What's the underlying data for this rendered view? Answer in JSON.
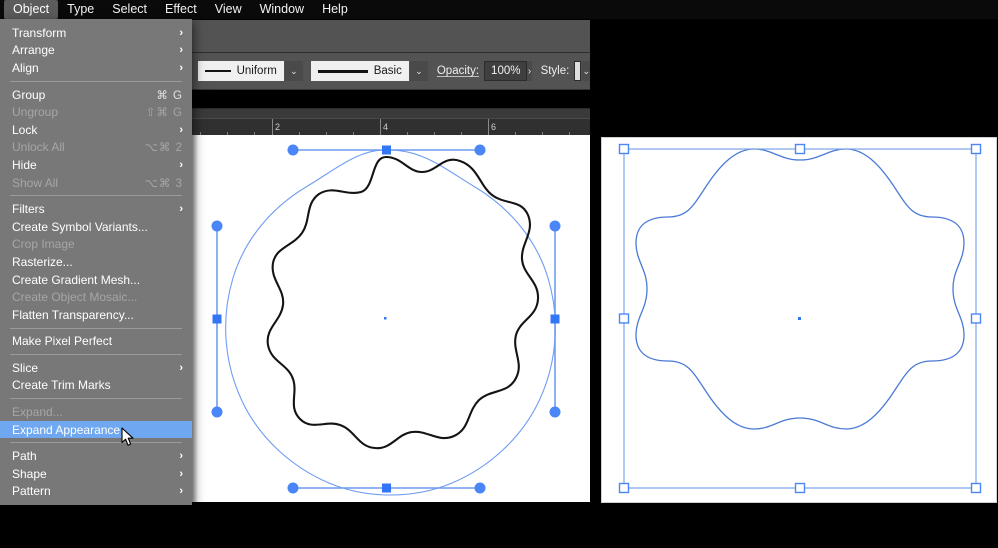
{
  "menubar": {
    "items": [
      {
        "label": "Object",
        "active": true
      },
      {
        "label": "Type",
        "active": false
      },
      {
        "label": "Select",
        "active": false
      },
      {
        "label": "Effect",
        "active": false
      },
      {
        "label": "View",
        "active": false
      },
      {
        "label": "Window",
        "active": false
      },
      {
        "label": "Help",
        "active": false
      }
    ]
  },
  "object_menu": {
    "groups": [
      {
        "items": [
          {
            "label": "Transform",
            "shortcut": "",
            "submenu": true,
            "disabled": false,
            "selected": false
          },
          {
            "label": "Arrange",
            "shortcut": "",
            "submenu": true,
            "disabled": false,
            "selected": false
          },
          {
            "label": "Align",
            "shortcut": "",
            "submenu": true,
            "disabled": false,
            "selected": false
          }
        ]
      },
      {
        "items": [
          {
            "label": "Group",
            "shortcut": "⌘ G",
            "submenu": false,
            "disabled": false,
            "selected": false
          },
          {
            "label": "Ungroup",
            "shortcut": "⇧⌘ G",
            "submenu": false,
            "disabled": true,
            "selected": false
          },
          {
            "label": "Lock",
            "shortcut": "",
            "submenu": true,
            "disabled": false,
            "selected": false
          },
          {
            "label": "Unlock All",
            "shortcut": "⌥⌘ 2",
            "submenu": false,
            "disabled": true,
            "selected": false
          },
          {
            "label": "Hide",
            "shortcut": "",
            "submenu": true,
            "disabled": false,
            "selected": false
          },
          {
            "label": "Show All",
            "shortcut": "⌥⌘ 3",
            "submenu": false,
            "disabled": true,
            "selected": false
          }
        ]
      },
      {
        "items": [
          {
            "label": "Filters",
            "shortcut": "",
            "submenu": true,
            "disabled": false,
            "selected": false
          },
          {
            "label": "Create Symbol Variants...",
            "shortcut": "",
            "submenu": false,
            "disabled": false,
            "selected": false
          },
          {
            "label": "Crop Image",
            "shortcut": "",
            "submenu": false,
            "disabled": true,
            "selected": false
          },
          {
            "label": "Rasterize...",
            "shortcut": "",
            "submenu": false,
            "disabled": false,
            "selected": false
          },
          {
            "label": "Create Gradient Mesh...",
            "shortcut": "",
            "submenu": false,
            "disabled": false,
            "selected": false
          },
          {
            "label": "Create Object Mosaic...",
            "shortcut": "",
            "submenu": false,
            "disabled": true,
            "selected": false
          },
          {
            "label": "Flatten Transparency...",
            "shortcut": "",
            "submenu": false,
            "disabled": false,
            "selected": false
          }
        ]
      },
      {
        "items": [
          {
            "label": "Make Pixel Perfect",
            "shortcut": "",
            "submenu": false,
            "disabled": false,
            "selected": false
          }
        ]
      },
      {
        "items": [
          {
            "label": "Slice",
            "shortcut": "",
            "submenu": true,
            "disabled": false,
            "selected": false
          },
          {
            "label": "Create Trim Marks",
            "shortcut": "",
            "submenu": false,
            "disabled": false,
            "selected": false
          }
        ]
      },
      {
        "items": [
          {
            "label": "Expand...",
            "shortcut": "",
            "submenu": false,
            "disabled": true,
            "selected": false
          },
          {
            "label": "Expand Appearance",
            "shortcut": "",
            "submenu": false,
            "disabled": false,
            "selected": true
          }
        ]
      },
      {
        "items": [
          {
            "label": "Path",
            "shortcut": "",
            "submenu": true,
            "disabled": false,
            "selected": false
          },
          {
            "label": "Shape",
            "shortcut": "",
            "submenu": true,
            "disabled": false,
            "selected": false
          },
          {
            "label": "Pattern",
            "shortcut": "",
            "submenu": true,
            "disabled": false,
            "selected": false
          }
        ]
      }
    ]
  },
  "controlbar": {
    "stroke_profile": "Uniform",
    "brush_definition": "Basic",
    "opacity_label": "Opacity:",
    "opacity_value": "100%",
    "opacity_more": "›",
    "style_label": "Style:",
    "chevron": "⌄"
  },
  "ruler": {
    "unit_marks": [
      "2",
      "4",
      "6"
    ],
    "mark_positions": [
      82,
      190,
      298
    ]
  },
  "colors": {
    "menu_background": "#787878",
    "menu_highlight": "#6fa8f0",
    "panel_background": "#535353",
    "selection_blue": "#4a86f7",
    "outline_blue": "#4a7ad6",
    "canvas_white": "#ffffff",
    "window_black": "#000000"
  },
  "artwork": {
    "left_canvas": {
      "name": "wavy-flower-shape-selected",
      "stroke_color": "#141414",
      "fill": "none",
      "lobes": 10,
      "selection": {
        "handle_color": "#4a86f7",
        "round_handles": 8,
        "square_handles": 4,
        "center_point": true
      }
    },
    "right_canvas": {
      "name": "wavy-flower-shape-outline",
      "stroke_color": "#4a7ad6",
      "fill": "none",
      "lobes": 8,
      "bounding_box_handles": 8
    }
  }
}
